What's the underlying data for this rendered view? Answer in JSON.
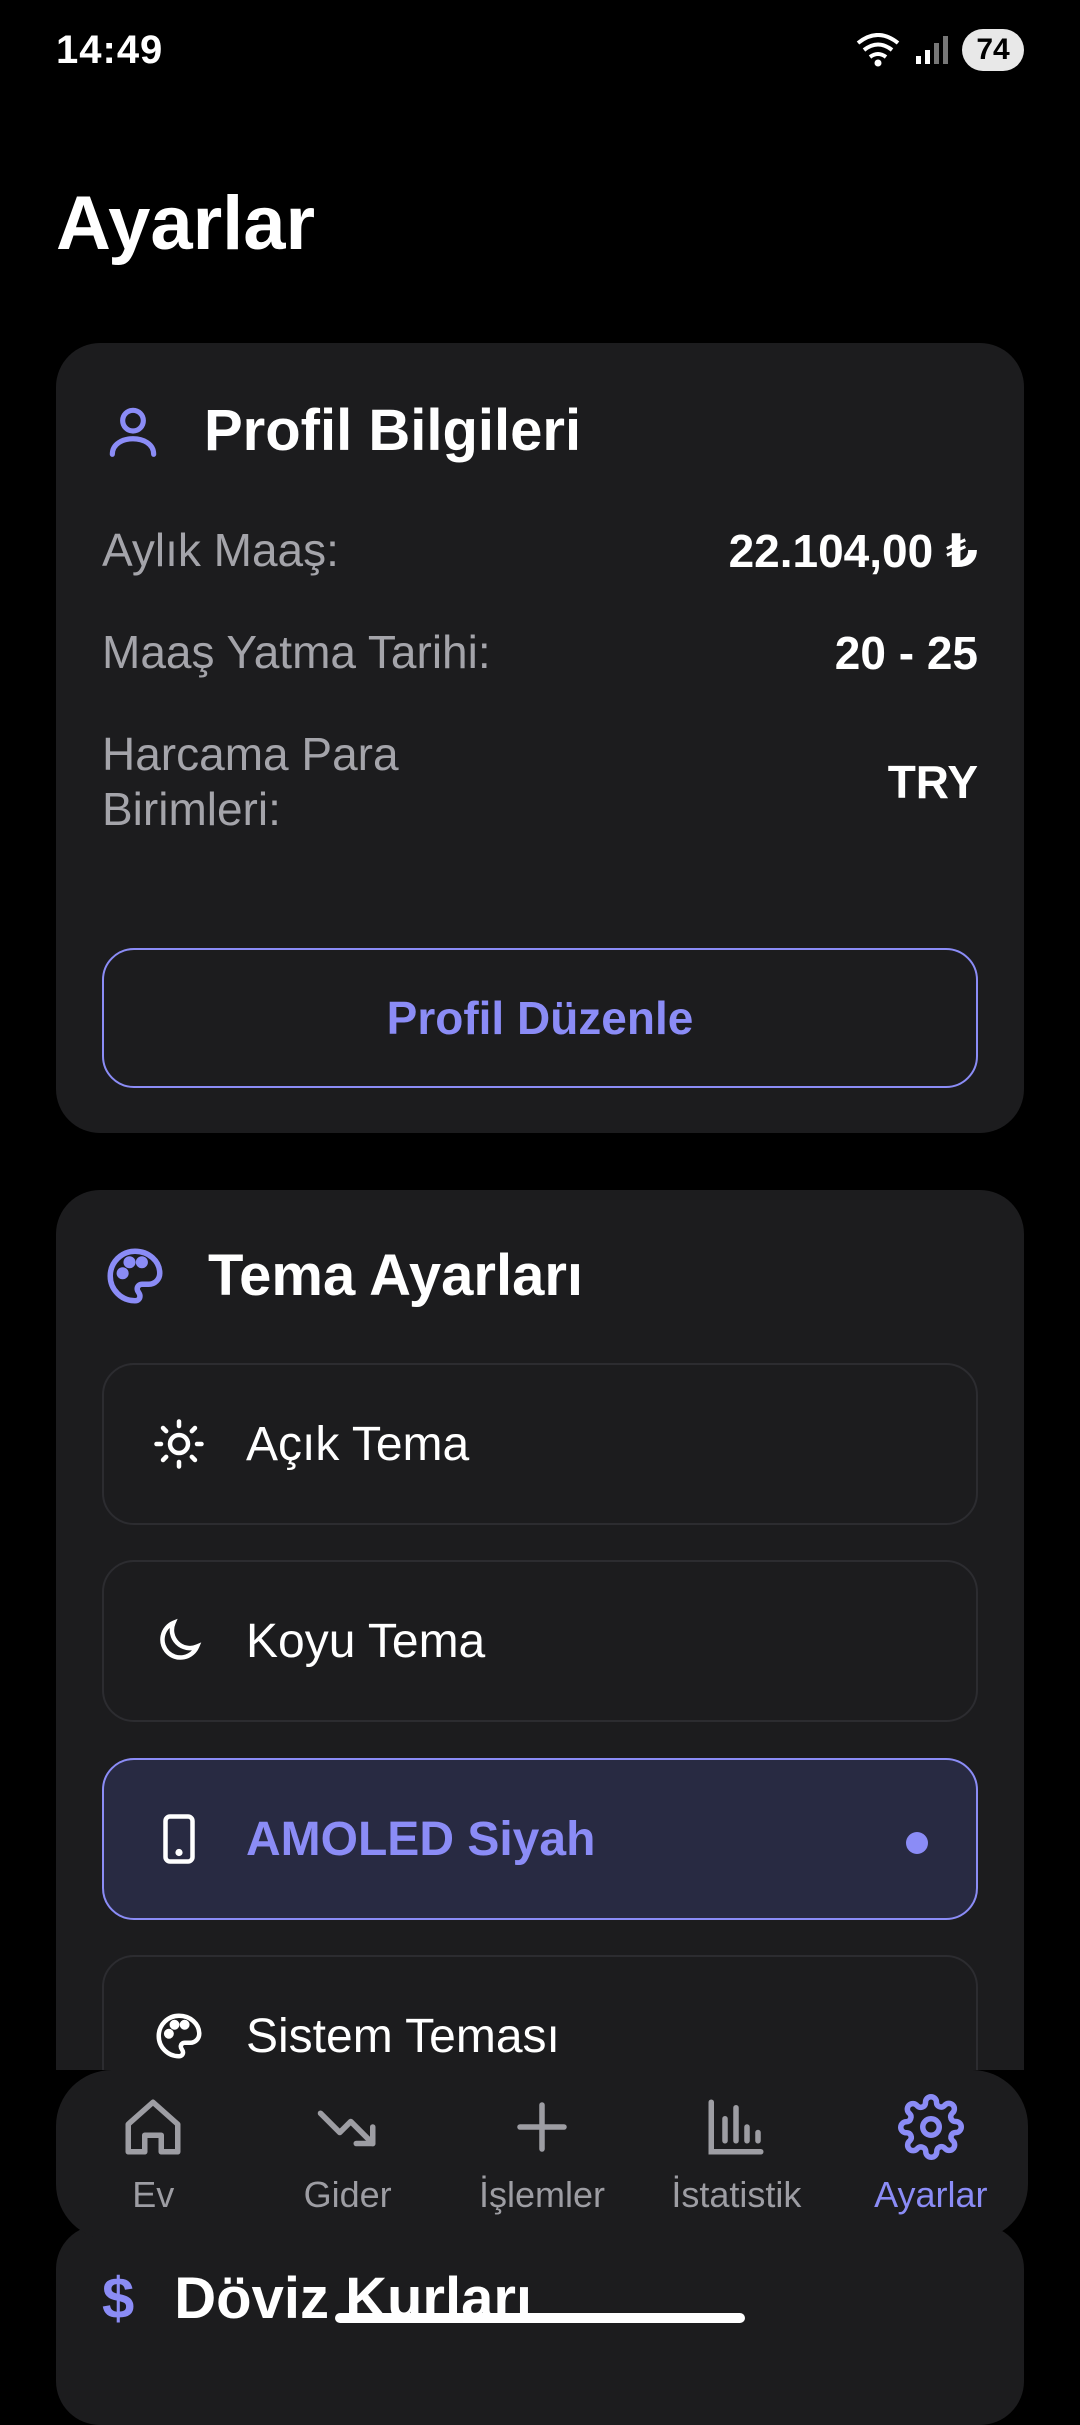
{
  "status_bar": {
    "time": "14:49",
    "battery": "74"
  },
  "page_title": "Ayarlar",
  "profile_card": {
    "title": "Profil Bilgileri",
    "rows": [
      {
        "label": "Aylık Maaş:",
        "value": "22.104,00 ₺"
      },
      {
        "label": "Maaş Yatma Tarihi:",
        "value": "20 - 25"
      },
      {
        "label": "Harcama Para Birimleri:",
        "value": "TRY"
      }
    ],
    "edit_button": "Profil Düzenle"
  },
  "theme_card": {
    "title": "Tema Ayarları",
    "options": [
      {
        "label": "Açık Tema",
        "icon": "sun-icon",
        "selected": false
      },
      {
        "label": "Koyu Tema",
        "icon": "moon-icon",
        "selected": false
      },
      {
        "label": "AMOLED Siyah",
        "icon": "phone-icon",
        "selected": true
      },
      {
        "label": "Sistem Teması",
        "icon": "palette-icon",
        "selected": false
      }
    ]
  },
  "partial_card": {
    "title": "Döviz Kurları"
  },
  "bottom_nav": {
    "items": [
      {
        "label": "Ev",
        "icon": "home-icon",
        "active": false
      },
      {
        "label": "Gider",
        "icon": "trending-down-icon",
        "active": false
      },
      {
        "label": "İşlemler",
        "icon": "plus-icon",
        "active": false
      },
      {
        "label": "İstatistik",
        "icon": "bar-chart-icon",
        "active": false
      },
      {
        "label": "Ayarlar",
        "icon": "gear-icon",
        "active": true
      }
    ]
  },
  "colors": {
    "accent": "#8b8cf6",
    "card": "#1c1c1e",
    "background": "#000000"
  }
}
